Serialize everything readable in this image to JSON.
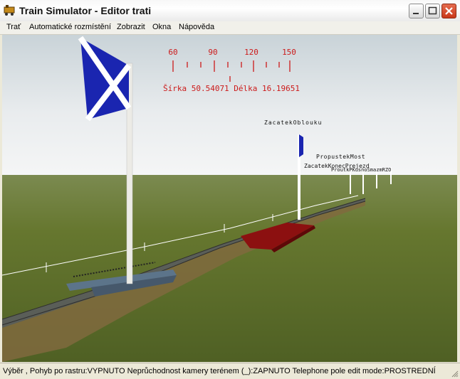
{
  "window": {
    "title": "Train Simulator - Editor trati"
  },
  "menu": [
    "Trať",
    "Automatické rozmístění",
    "Zobrazit",
    "Okna",
    "Nápověda"
  ],
  "compass": {
    "ticks": [
      "60",
      "90",
      "120",
      "150"
    ],
    "coords": "Šírka 50.54071 Délka 16.19651"
  },
  "markers": {
    "m1": "ZacatekOblouku",
    "m2": "PropustekMost",
    "m3": "ZacatekKonecPrejezd",
    "m4": "ProutkPKusnoSmazmRZO"
  },
  "status": "Výběr , Pohyb po rastru:VYPNUTO Neprůchodnost kamery terénem (_):ZAPNUTO Telephone pole edit mode:PROSTREDNÍ",
  "colors": {
    "flag_blue": "#1a25b0",
    "compass_red": "#cc1a1a",
    "bridge_red": "#8c1010",
    "grass": "#5e6e2c"
  }
}
